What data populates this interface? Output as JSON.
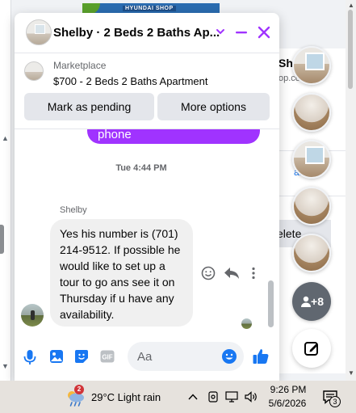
{
  "background": {
    "ad_text": "HYUNDAI SHOP",
    "right_title": "Sh",
    "right_subtitle": "op.co",
    "right_delete": "elete",
    "right_link": "al"
  },
  "chat": {
    "title": "Shelby · 2 Beds 2 Baths Ap...",
    "marketplace_label": "Marketplace",
    "listing": "$700 - 2 Beds 2 Baths Apartment",
    "mark_pending_label": "Mark as pending",
    "more_options_label": "More options",
    "sent_partial": "phone",
    "timestamp": "Tue 4:44 PM",
    "sender_name": "Shelby",
    "received_message": "Yes his number is (701) 214-9512. If possible he would like to set up a tour to go ans see it on Thursday if u have any availability.",
    "composer_placeholder": "Aa",
    "accent_color": "#a033ff",
    "icon_color": "#1877f2"
  },
  "chatheads": {
    "more_count": "+8"
  },
  "taskbar": {
    "weather_badge": "2",
    "weather_text": "29°C  Light rain",
    "time": "9:26 PM",
    "date": "5/6/2026",
    "notification_count": "3"
  }
}
